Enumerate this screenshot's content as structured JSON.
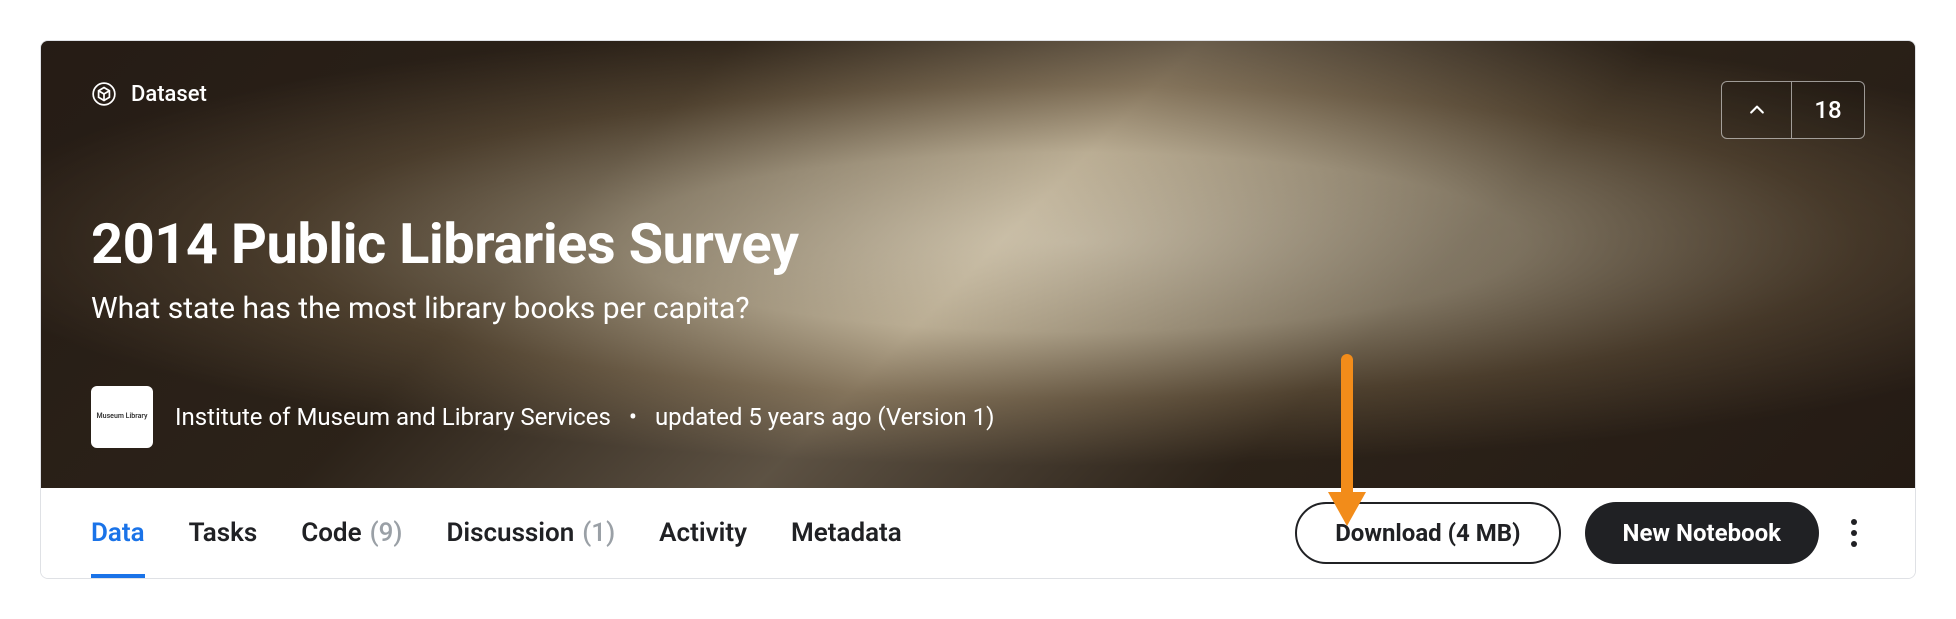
{
  "header": {
    "type_label": "Dataset",
    "upvote_count": "18",
    "title": "2014 Public Libraries Survey",
    "subtitle": "What state has the most library books per capita?"
  },
  "author": {
    "name": "Institute of Museum and Library Services",
    "updated": "updated 5 years ago (Version 1)",
    "avatar_text": "Museum Library"
  },
  "tabs": [
    {
      "label": "Data",
      "count": null,
      "active": true
    },
    {
      "label": "Tasks",
      "count": null,
      "active": false
    },
    {
      "label": "Code",
      "count": "(9)",
      "active": false
    },
    {
      "label": "Discussion",
      "count": "(1)",
      "active": false
    },
    {
      "label": "Activity",
      "count": null,
      "active": false
    },
    {
      "label": "Metadata",
      "count": null,
      "active": false
    }
  ],
  "actions": {
    "download_label": "Download (4 MB)",
    "new_notebook_label": "New Notebook"
  },
  "colors": {
    "accent": "#1a73e8",
    "dark": "#202124",
    "annotation": "#f28c1a"
  }
}
